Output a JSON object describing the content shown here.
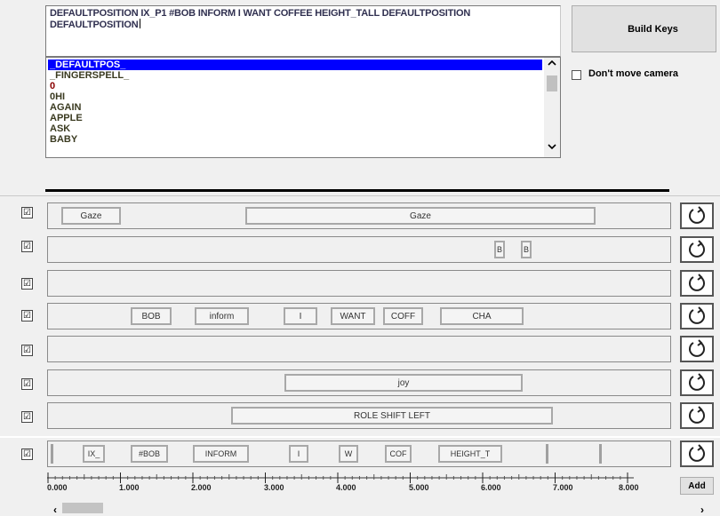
{
  "sequence_text": "DEFAULTPOSITION IX_P1 #BOB INFORM I WANT COFFEE HEIGHT_TALL DEFAULTPOSITION DEFAULTPOSITION",
  "sign_list": {
    "items": [
      "_DEFAULTPOS_",
      "_FINGERSPELL_",
      "0",
      "0HI",
      "AGAIN",
      "APPLE",
      "ASK",
      "BABY"
    ],
    "selected": "_DEFAULTPOS_",
    "scroll_up": "^",
    "scroll_down": "v"
  },
  "build_keys_label": "Build Keys",
  "camera_option": {
    "label": "Don't move camera",
    "checked": false
  },
  "tracks": [
    {
      "checked": true,
      "check_mark": "☑",
      "blocks": [
        "Gaze",
        "Gaze"
      ]
    },
    {
      "checked": true,
      "check_mark": "☑",
      "blocks": [
        "B",
        "B"
      ]
    },
    {
      "checked": true,
      "check_mark": "☑",
      "blocks": []
    },
    {
      "checked": true,
      "check_mark": "☑",
      "blocks": [
        "BOB",
        "inform",
        "I",
        "WANT",
        "COFF",
        "CHA"
      ]
    },
    {
      "checked": true,
      "check_mark": "☑",
      "blocks": []
    },
    {
      "checked": true,
      "check_mark": "☑",
      "blocks": [
        "joy"
      ]
    },
    {
      "checked": true,
      "check_mark": "☑",
      "blocks": [
        "ROLE SHIFT LEFT"
      ]
    },
    {
      "checked": true,
      "check_mark": "☑",
      "blocks": [
        "IX_",
        "#BOB",
        "INFORM",
        "I",
        "W",
        "COF",
        "HEIGHT_T"
      ]
    }
  ],
  "reset_icon": "rotate-icon",
  "timeline": {
    "ticks": [
      "0.000",
      "1.000",
      "2.000",
      "3.000",
      "4.000",
      "5.000",
      "6.000",
      "7.000",
      "8.000"
    ]
  },
  "add_label": "Add",
  "hscroll": {
    "left": "‹",
    "right": "›"
  }
}
